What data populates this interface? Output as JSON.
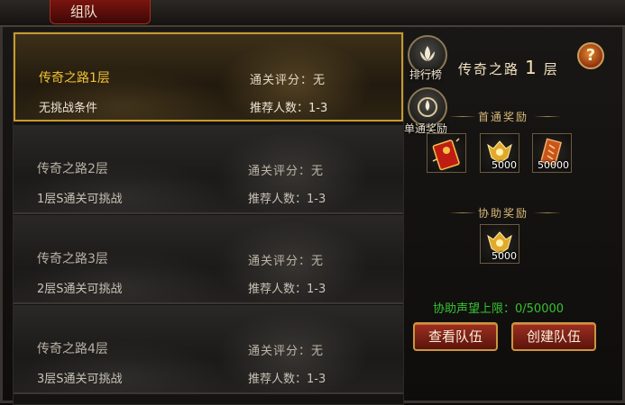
{
  "window": {
    "title": "组队"
  },
  "stages": [
    {
      "name": "传奇之路1层",
      "score_label": "通关评分：",
      "score_value": "无",
      "condition": "无挑战条件",
      "recommend": "推荐人数：1-3",
      "selected": true
    },
    {
      "name": "传奇之路2层",
      "score_label": "通关评分：",
      "score_value": "无",
      "condition": "1层S通关可挑战",
      "recommend": "推荐人数：1-3",
      "selected": false
    },
    {
      "name": "传奇之路3层",
      "score_label": "通关评分：",
      "score_value": "无",
      "condition": "2层S通关可挑战",
      "recommend": "推荐人数：1-3",
      "selected": false
    },
    {
      "name": "传奇之路4层",
      "score_label": "通关评分：",
      "score_value": "无",
      "condition": "3层S通关可挑战",
      "recommend": "推荐人数：1-3",
      "selected": false
    }
  ],
  "side": {
    "ranking_label": "排行榜",
    "single_reward_label": "单通奖励",
    "stage_title_prefix": "传奇之路",
    "stage_title_num": "1",
    "stage_title_suffix": "层",
    "help_symbol": "?",
    "first_reward_title": "首通奖励",
    "first_rewards": [
      {
        "icon": "red-envelope-icon",
        "count": ""
      },
      {
        "icon": "gold-crest-icon",
        "count": "5000"
      },
      {
        "icon": "scroll-icon",
        "count": "50000"
      }
    ],
    "assist_reward_title": "协助奖励",
    "assist_rewards": [
      {
        "icon": "gold-crest-icon",
        "count": "5000"
      }
    ],
    "assist_limit": "协助声望上限：0/50000",
    "view_team_label": "查看队伍",
    "create_team_label": "创建队伍"
  },
  "colors": {
    "selected_name": "#f1c232",
    "limit_text": "#36c230",
    "button_red": "#9b2f20",
    "gold_border": "#c79a2e"
  }
}
